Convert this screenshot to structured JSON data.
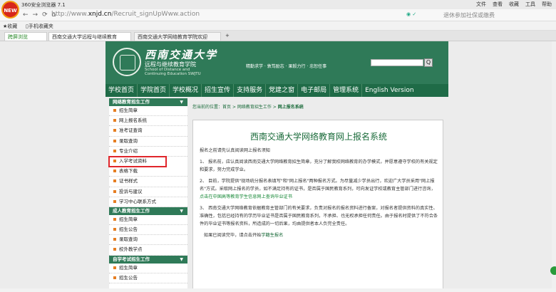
{
  "browser": {
    "badge": "NEW",
    "title": "360安全浏览器 7.1",
    "menu": [
      "文件",
      "查看",
      "收藏",
      "工具",
      "帮助"
    ],
    "url_prefix": "http://www.",
    "url_domain": "xnjd.cn",
    "url_path": "/Recruit_signUpWww.action",
    "search_placeholder": "退休参加社保或缴费",
    "fav_label": "收藏",
    "fav_item": "手机收藏夹",
    "tabs": [
      {
        "label": "跨屏浏览"
      },
      {
        "label": "西南交通大学远程与继续教育"
      },
      {
        "label": "西南交通大学网络教育学院欢迎"
      }
    ],
    "new_tab": "+"
  },
  "header": {
    "logo_cn": "西南交通大学",
    "logo_sub": "远程与继续教育学院",
    "logo_en_1": "School of Distance and",
    "logo_en_2": "Continuing Education SWJTU",
    "motto": "精勤求学 · 敦笃励志 · 果毅力行 · 忠恕任事",
    "search_btn": "Q"
  },
  "nav": [
    "学校首页",
    "学院首页",
    "学校概况",
    "招生宣传",
    "支持服务",
    "党建之窗",
    "电子邮局",
    "管理系统",
    "English Version"
  ],
  "sidebar": {
    "sections": [
      {
        "title": "网络教育招生工作",
        "items": [
          "招生简章",
          "网上报名系统",
          "准考证查询",
          "录取查询",
          "专业介绍",
          "入学考试资料",
          "表格下载",
          "证书样式",
          "投诉与建议",
          "学习中心联系方式"
        ]
      },
      {
        "title": "成人教育招生工作",
        "items": [
          "招生简章",
          "招生公告",
          "录取查询",
          "校外教学点"
        ]
      },
      {
        "title": "自学考试招生工作",
        "items": [
          "招生简章",
          "招生公告"
        ]
      }
    ],
    "highlighted": "入学考试资料"
  },
  "breadcrumb": {
    "prefix": "您当前的位置：",
    "home": "首页",
    "sep": " > ",
    "section": "网络教育招生工作",
    "current": "网上报名系统"
  },
  "content": {
    "title": "西南交通大学网络教育网上报名系统",
    "intro": "报名之前请先认真阅读网上报名须知",
    "p1": "1、 报名前，应认真阅读西南交通大学网络教育招生简章，充分了解我校网络教育的办学模式，并愿意遵守学校的有关规定和要求，努力完成学业。",
    "p2a": "2、 目前，学院提供\"现场统分报名表填写\"和\"网上报名\"两种报名方式。为尽量减少学员出行，欢迎广大学员采用\"网上报名\"方式。采取网上报名的学员，如不满足持有的证书，是否属于国民教育系列，可向发证学校或教育主管部门进行咨询，",
    "p2b": "点击在中国高等教育学生信息网上查询毕业证书",
    "p3": "3、 西南交通大学网络教育依据教育主管部门的有关要求，负责对报名的报名资料进行备案，对报名者提供资料的真实性、准确性，包括已经持有的学历毕业证书是否属于国民教育系列，不承担、也无权承担任何责任。由于报名时提供了不符合条件的毕业证书等报名资料，所造成的一切后果，均由提供者本人负完全责任。",
    "p4a": "如果已阅读完毕，请点击开始",
    "p4b": "学籍生报名"
  }
}
